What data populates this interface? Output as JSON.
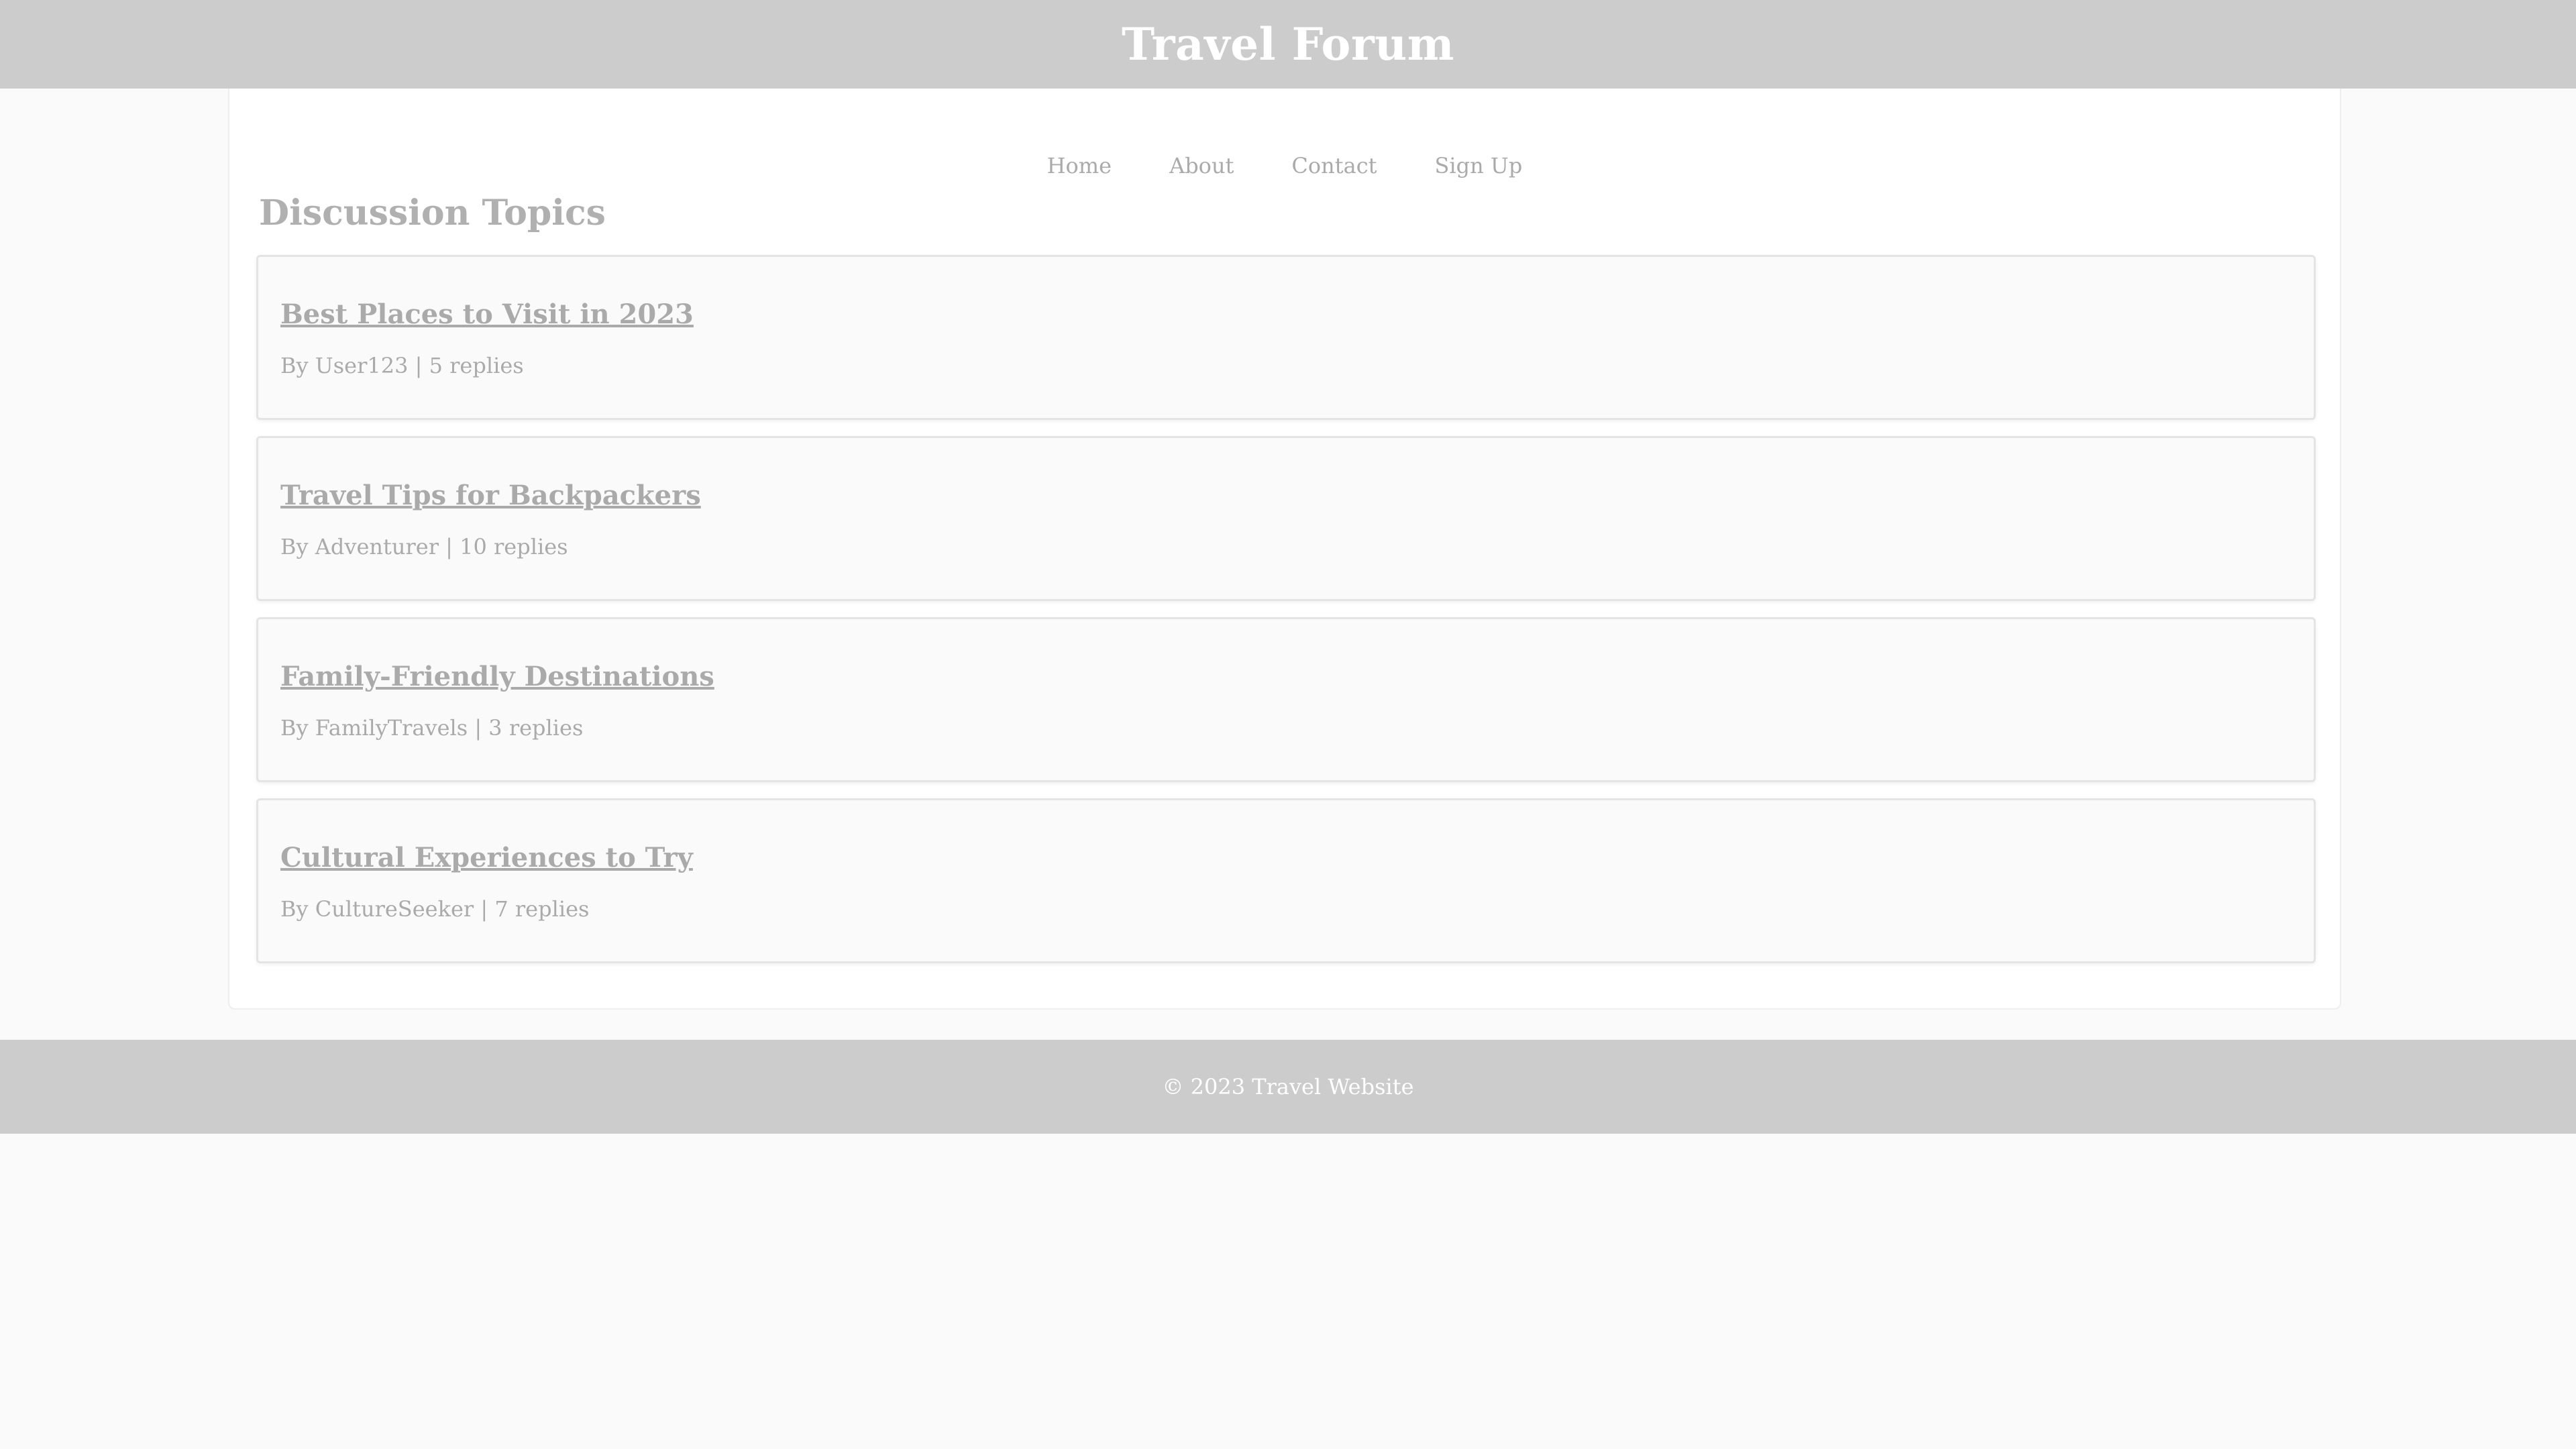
{
  "header": {
    "title": "Travel Forum"
  },
  "nav": {
    "items": [
      "Home",
      "About",
      "Contact",
      "Sign Up"
    ]
  },
  "main": {
    "section_title": "Discussion Topics",
    "topics": [
      {
        "title": "Best Places to Visit in 2023",
        "meta": "By User123 | 5 replies"
      },
      {
        "title": "Travel Tips for Backpackers",
        "meta": "By Adventurer | 10 replies"
      },
      {
        "title": "Family-Friendly Destinations",
        "meta": "By FamilyTravels | 3 replies"
      },
      {
        "title": "Cultural Experiences to Try",
        "meta": "By CultureSeeker | 7 replies"
      }
    ]
  },
  "footer": {
    "text": "© 2023 Travel Website"
  },
  "colors": {
    "header_bg": "#cccccc",
    "footer_bg": "#cccccc",
    "page_bg": "#fafafa",
    "text_muted": "#aaaaaa"
  }
}
